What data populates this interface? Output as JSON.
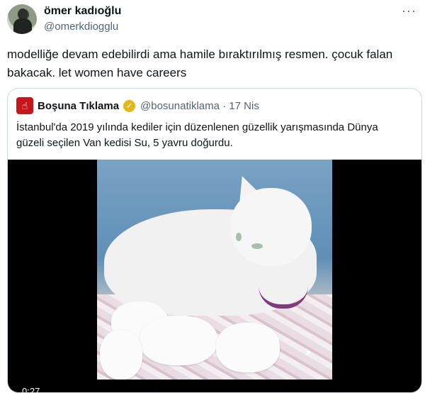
{
  "tweet": {
    "author_name": "ömer kadıoğlu",
    "author_handle": "@omerkdiogglu",
    "more_icon": "more-icon",
    "text_line1": "modelliğe devam edebilirdi ama hamile bıraktırılmış resmen. çocuk falan",
    "text_line2": "bakacak. let women have careers"
  },
  "quoted": {
    "author_name": "Boşuna Tıklama",
    "verified_icon": "verified-badge-icon",
    "author_handle": "@bosunatiklama",
    "separator": "·",
    "date": "17 Nis",
    "text_line1": "İstanbul'da 2019 yılında kediler için düzenlenen güzellik yarışmasında Dünya",
    "text_line2": "güzeli seçilen Van kedisi Su, 5 yavru doğurdu.",
    "video": {
      "timestamp": "0:27",
      "accent": "#c4161c"
    }
  }
}
